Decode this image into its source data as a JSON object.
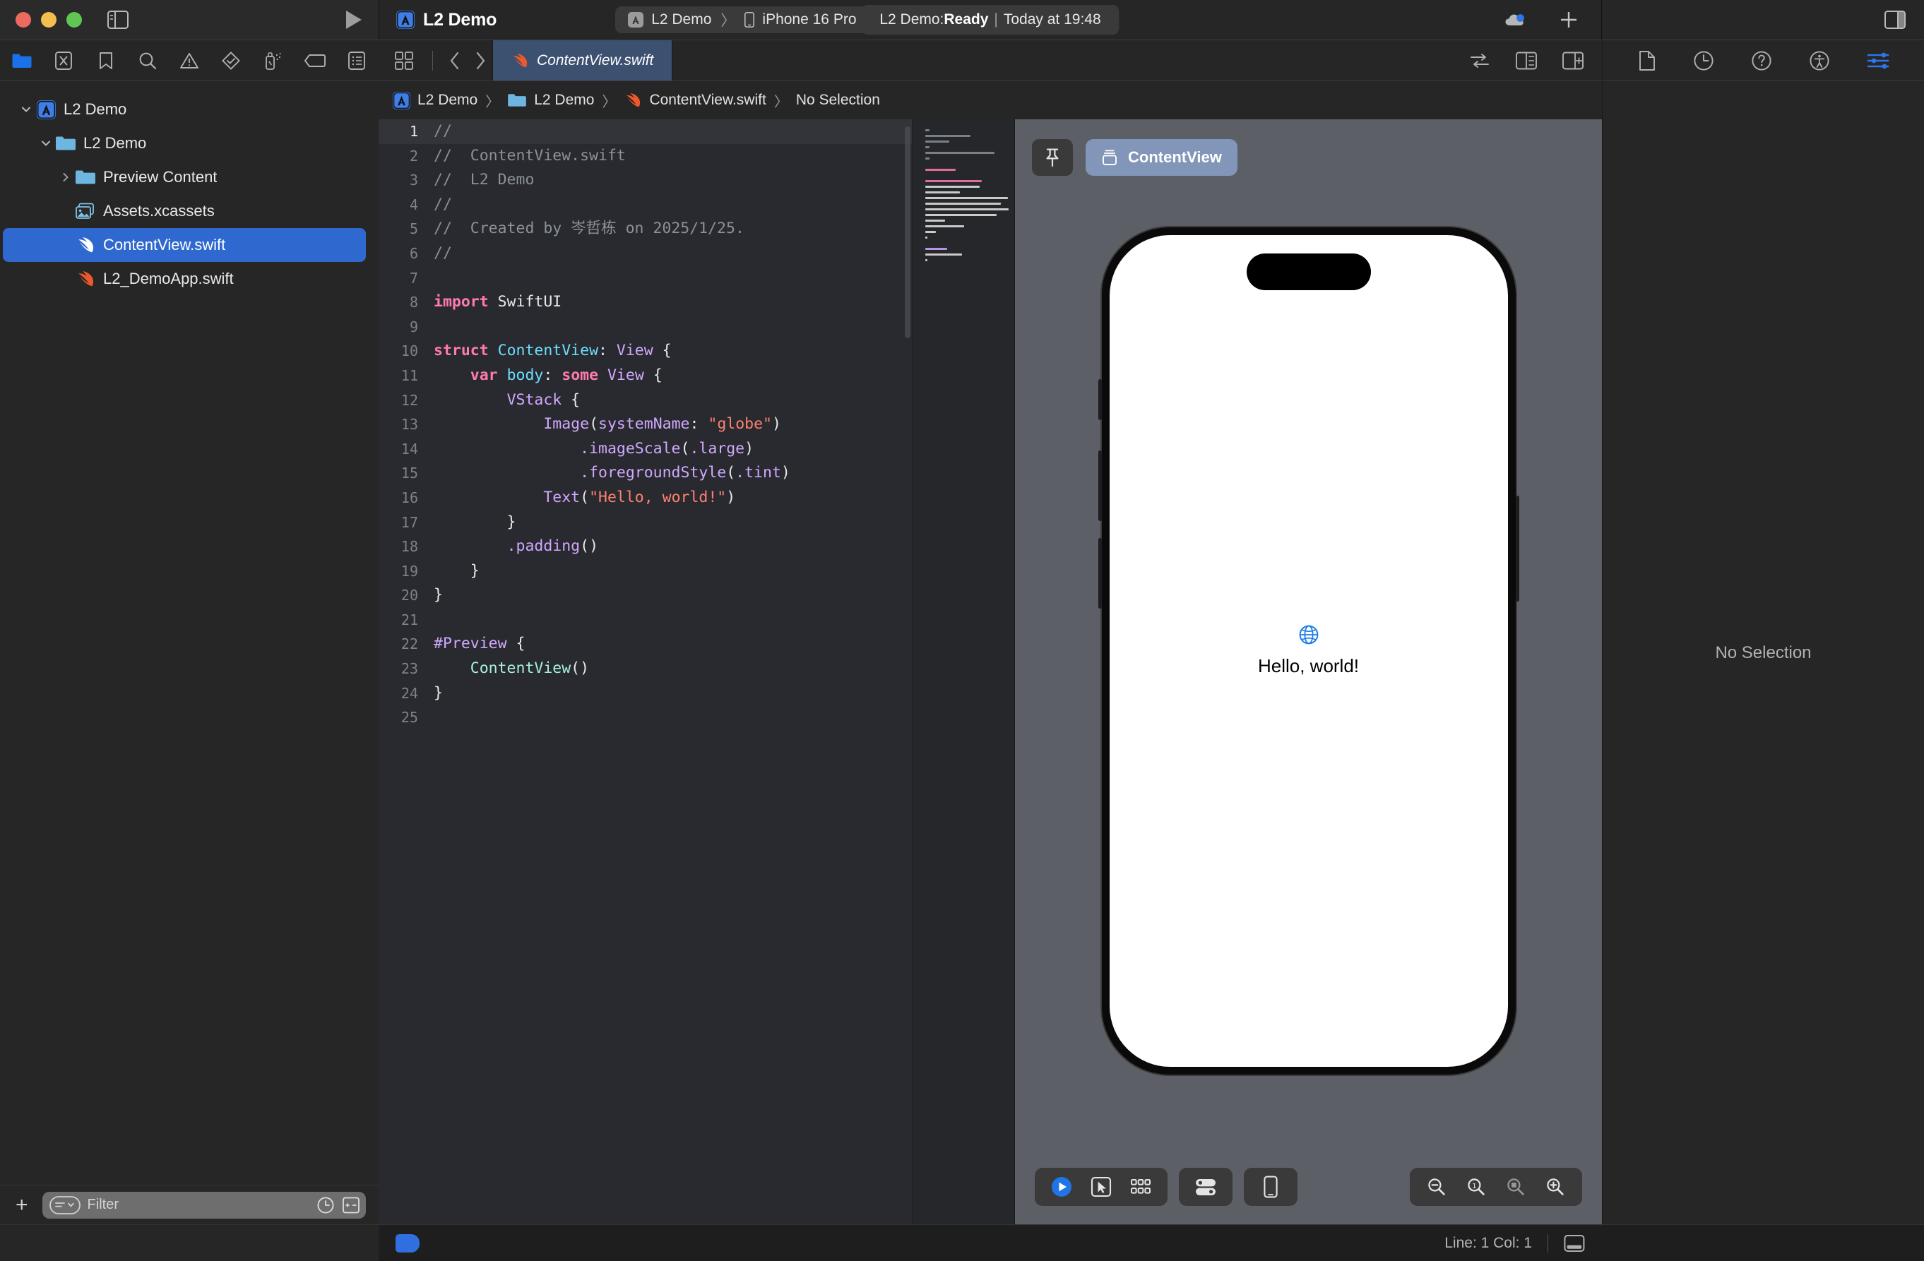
{
  "window": {
    "app_icon": "xcode-app-icon",
    "project_title": "L2 Demo"
  },
  "toolbar": {
    "traffic_lights": [
      "close",
      "minimize",
      "zoom"
    ],
    "sidebar_toggle_icon": "sidebar-toggle-icon",
    "run_icon": "run-play-icon",
    "scheme": {
      "scheme_name": "L2 Demo",
      "separator": "〉",
      "destination": "iPhone 16 Pro"
    },
    "status": {
      "prefix": "L2 Demo: ",
      "state": "Ready",
      "divider": "|",
      "time": "Today at 19:48"
    },
    "cloud_icon": "cloud-status-icon",
    "add_icon": "add-plus-icon",
    "inspector_toggle_icon": "inspector-toggle-icon"
  },
  "navigator": {
    "tabs": [
      {
        "name": "project-navigator",
        "icon": "folder-icon"
      },
      {
        "name": "source-control-navigator",
        "icon": "source-control-icon"
      },
      {
        "name": "bookmark-navigator",
        "icon": "bookmark-icon"
      },
      {
        "name": "find-navigator",
        "icon": "search-icon"
      },
      {
        "name": "issue-navigator",
        "icon": "warning-triangle-icon"
      },
      {
        "name": "test-navigator",
        "icon": "diamond-check-icon"
      },
      {
        "name": "debug-navigator",
        "icon": "spray-can-icon"
      },
      {
        "name": "breakpoint-navigator",
        "icon": "breakpoint-tag-icon"
      },
      {
        "name": "report-navigator",
        "icon": "report-list-icon"
      }
    ],
    "tree": [
      {
        "label": "L2 Demo",
        "icon": "xcode-project-icon",
        "depth": 0,
        "disclosure": "open",
        "selected": false
      },
      {
        "label": "L2 Demo",
        "icon": "folder-blue-icon",
        "depth": 1,
        "disclosure": "open",
        "selected": false
      },
      {
        "label": "Preview Content",
        "icon": "folder-blue-icon",
        "depth": 2,
        "disclosure": "closed",
        "selected": false
      },
      {
        "label": "Assets.xcassets",
        "icon": "assets-catalog-icon",
        "depth": 2,
        "disclosure": "none",
        "selected": false
      },
      {
        "label": "ContentView.swift",
        "icon": "swift-file-icon",
        "depth": 2,
        "disclosure": "none",
        "selected": true
      },
      {
        "label": "L2_DemoApp.swift",
        "icon": "swift-file-icon",
        "depth": 2,
        "disclosure": "none",
        "selected": false
      }
    ],
    "filter": {
      "add_label": "+",
      "placeholder": "Filter",
      "recent_icon": "clock-icon",
      "expand_icon": "expand-all-icon"
    }
  },
  "editor": {
    "jumpbar_icons": [
      "related-items-icon",
      "back-chevron-icon",
      "forward-chevron-icon"
    ],
    "tabs": [
      {
        "label": "ContentView.swift",
        "icon": "swift-file-icon",
        "selected": true
      }
    ],
    "right_icons": [
      "code-review-icon",
      "adjust-editor-icon",
      "add-editor-icon"
    ],
    "breadcrumb": [
      {
        "label": "L2 Demo",
        "icon": "xcode-project-icon"
      },
      {
        "label": "L2 Demo",
        "icon": "folder-blue-icon"
      },
      {
        "label": "ContentView.swift",
        "icon": "swift-file-icon"
      },
      {
        "label": "No Selection",
        "icon": "none"
      }
    ],
    "breadcrumb_separator": "〉",
    "code_lines": [
      {
        "n": "1",
        "current": true,
        "tokens": [
          {
            "t": "//",
            "c": "comment"
          }
        ]
      },
      {
        "n": "2",
        "current": false,
        "tokens": [
          {
            "t": "//  ContentView.swift",
            "c": "comment"
          }
        ]
      },
      {
        "n": "3",
        "current": false,
        "tokens": [
          {
            "t": "//  L2 Demo",
            "c": "comment"
          }
        ]
      },
      {
        "n": "4",
        "current": false,
        "tokens": [
          {
            "t": "//",
            "c": "comment"
          }
        ]
      },
      {
        "n": "5",
        "current": false,
        "tokens": [
          {
            "t": "//  Created by 岑哲栋 on 2025/1/25.",
            "c": "comment"
          }
        ]
      },
      {
        "n": "6",
        "current": false,
        "tokens": [
          {
            "t": "//",
            "c": "comment"
          }
        ]
      },
      {
        "n": "7",
        "current": false,
        "tokens": []
      },
      {
        "n": "8",
        "current": false,
        "tokens": [
          {
            "t": "import",
            "c": "kw"
          },
          {
            "t": " SwiftUI",
            "c": "plain"
          }
        ]
      },
      {
        "n": "9",
        "current": false,
        "tokens": []
      },
      {
        "n": "10",
        "current": false,
        "tokens": [
          {
            "t": "struct",
            "c": "kw"
          },
          {
            "t": " ",
            "c": "plain"
          },
          {
            "t": "ContentView",
            "c": "decl"
          },
          {
            "t": ": ",
            "c": "plain"
          },
          {
            "t": "View",
            "c": "type"
          },
          {
            "t": " {",
            "c": "plain"
          }
        ]
      },
      {
        "n": "11",
        "current": false,
        "tokens": [
          {
            "t": "    ",
            "c": "plain"
          },
          {
            "t": "var",
            "c": "kw"
          },
          {
            "t": " ",
            "c": "plain"
          },
          {
            "t": "body",
            "c": "decl"
          },
          {
            "t": ": ",
            "c": "plain"
          },
          {
            "t": "some",
            "c": "kw"
          },
          {
            "t": " ",
            "c": "plain"
          },
          {
            "t": "View",
            "c": "type"
          },
          {
            "t": " {",
            "c": "plain"
          }
        ]
      },
      {
        "n": "12",
        "current": false,
        "tokens": [
          {
            "t": "        ",
            "c": "plain"
          },
          {
            "t": "VStack",
            "c": "type"
          },
          {
            "t": " {",
            "c": "plain"
          }
        ]
      },
      {
        "n": "13",
        "current": false,
        "tokens": [
          {
            "t": "            ",
            "c": "plain"
          },
          {
            "t": "Image",
            "c": "type"
          },
          {
            "t": "(",
            "c": "plain"
          },
          {
            "t": "systemName",
            "c": "type"
          },
          {
            "t": ": ",
            "c": "plain"
          },
          {
            "t": "\"globe\"",
            "c": "str"
          },
          {
            "t": ")",
            "c": "plain"
          }
        ]
      },
      {
        "n": "14",
        "current": false,
        "tokens": [
          {
            "t": "                ",
            "c": "plain"
          },
          {
            "t": ".imageScale",
            "c": "type"
          },
          {
            "t": "(",
            "c": "plain"
          },
          {
            "t": ".large",
            "c": "type"
          },
          {
            "t": ")",
            "c": "plain"
          }
        ]
      },
      {
        "n": "15",
        "current": false,
        "tokens": [
          {
            "t": "                ",
            "c": "plain"
          },
          {
            "t": ".foregroundStyle",
            "c": "type"
          },
          {
            "t": "(",
            "c": "plain"
          },
          {
            "t": ".tint",
            "c": "type"
          },
          {
            "t": ")",
            "c": "plain"
          }
        ]
      },
      {
        "n": "16",
        "current": false,
        "tokens": [
          {
            "t": "            ",
            "c": "plain"
          },
          {
            "t": "Text",
            "c": "type"
          },
          {
            "t": "(",
            "c": "plain"
          },
          {
            "t": "\"Hello, world!\"",
            "c": "str"
          },
          {
            "t": ")",
            "c": "plain"
          }
        ]
      },
      {
        "n": "17",
        "current": false,
        "tokens": [
          {
            "t": "        }",
            "c": "plain"
          }
        ]
      },
      {
        "n": "18",
        "current": false,
        "tokens": [
          {
            "t": "        ",
            "c": "plain"
          },
          {
            "t": ".padding",
            "c": "type"
          },
          {
            "t": "()",
            "c": "plain"
          }
        ]
      },
      {
        "n": "19",
        "current": false,
        "tokens": [
          {
            "t": "    }",
            "c": "plain"
          }
        ]
      },
      {
        "n": "20",
        "current": false,
        "tokens": [
          {
            "t": "}",
            "c": "plain"
          }
        ]
      },
      {
        "n": "21",
        "current": false,
        "tokens": []
      },
      {
        "n": "22",
        "current": false,
        "tokens": [
          {
            "t": "#Preview",
            "c": "type"
          },
          {
            "t": " {",
            "c": "plain"
          }
        ]
      },
      {
        "n": "23",
        "current": false,
        "tokens": [
          {
            "t": "    ",
            "c": "plain"
          },
          {
            "t": "ContentView",
            "c": "mint"
          },
          {
            "t": "()",
            "c": "plain"
          }
        ]
      },
      {
        "n": "24",
        "current": false,
        "tokens": [
          {
            "t": "}",
            "c": "plain"
          }
        ]
      },
      {
        "n": "25",
        "current": false,
        "tokens": []
      }
    ]
  },
  "preview": {
    "pin_icon": "pin-icon",
    "view_pill": {
      "label": "ContentView",
      "icon": "preview-view-icon"
    },
    "device": {
      "name": "iPhone 16 Pro"
    },
    "app_screen": {
      "image_icon": "globe-icon",
      "text": "Hello, world!"
    },
    "controls": {
      "play_icon": "preview-play-icon",
      "select_icon": "preview-select-icon",
      "variants_icon": "preview-variants-icon",
      "device_settings_icon": "device-settings-icon",
      "device_icon": "device-iphone-icon",
      "zoom_out_icon": "zoom-out-icon",
      "zoom_actual_icon": "zoom-100-icon",
      "zoom_fit_icon": "zoom-fit-icon",
      "zoom_in_icon": "zoom-in-icon"
    }
  },
  "inspector": {
    "tabs": [
      {
        "name": "file-inspector",
        "icon": "document-icon",
        "selected": false
      },
      {
        "name": "history-inspector",
        "icon": "clock-icon",
        "selected": false
      },
      {
        "name": "quick-help-inspector",
        "icon": "question-circle-icon",
        "selected": false
      },
      {
        "name": "accessibility-inspector",
        "icon": "accessibility-icon",
        "selected": false
      },
      {
        "name": "attributes-inspector",
        "icon": "sliders-icon",
        "selected": true
      }
    ],
    "empty_message": "No Selection"
  },
  "statusbar": {
    "line_col": "Line: 1  Col: 1",
    "console_toggle_icon": "console-toggle-icon",
    "tag_icon": "breakpoint-tag-icon"
  },
  "colors": {
    "accent_blue": "#2f68cf",
    "tab_selected": "#3c5070",
    "canvas_bg": "#5c5f66",
    "syntax_keyword": "#ff7ab2",
    "syntax_type": "#d0a8ff",
    "syntax_decl": "#6bdfff",
    "syntax_string": "#ff8170",
    "syntax_comment": "#8a9199",
    "syntax_mint": "#a6efdf"
  }
}
